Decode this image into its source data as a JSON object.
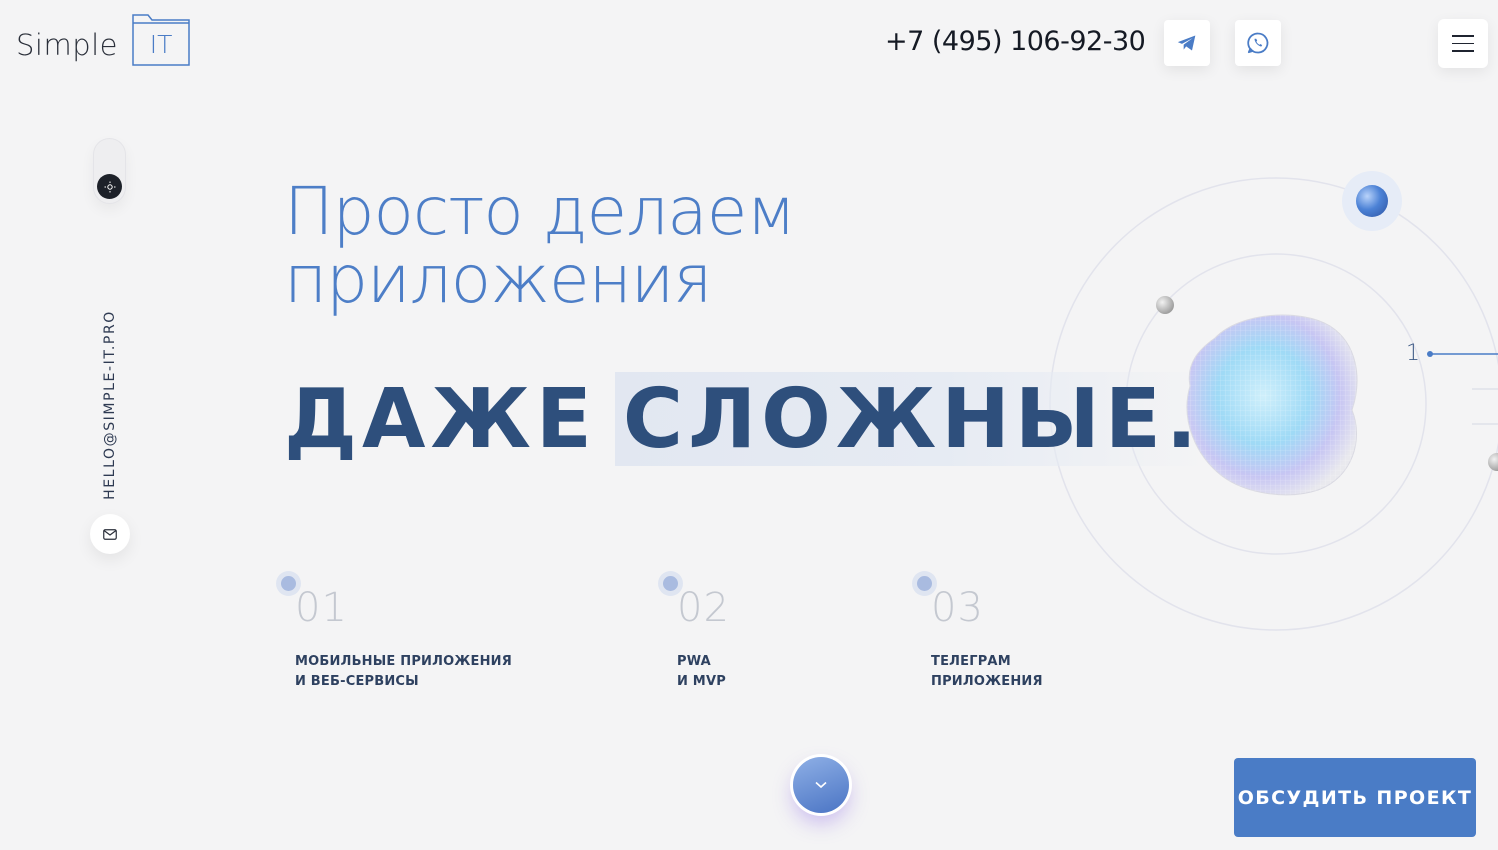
{
  "header": {
    "logo_word": "Simple",
    "logo_box": "IT",
    "phone": "+7 (495) 106-92-30",
    "telegram_icon": "telegram-icon",
    "whatsapp_icon": "whatsapp-icon",
    "menu_icon": "hamburger-icon"
  },
  "sidebar": {
    "theme_icon": "sun-icon",
    "email": "HELLO@SIMPLE-IT.PRO",
    "mail_icon": "envelope-icon"
  },
  "hero": {
    "title_line1": "Просто делаем",
    "title_line2": "приложения",
    "strong_word1": "ДАЖЕ",
    "strong_word2": "СЛОЖНЫЕ",
    "strong_dot": "."
  },
  "services": [
    {
      "num": "01",
      "line1": "МОБИЛЬНЫЕ ПРИЛОЖЕНИЯ",
      "line2": "И ВЕБ-СЕРВИСЫ"
    },
    {
      "num": "02",
      "line1": "PWA",
      "line2": "И MVP"
    },
    {
      "num": "03",
      "line1": "ТЕЛЕГРАМ",
      "line2": "ПРИЛОЖЕНИЯ"
    }
  ],
  "slider": {
    "current": "1"
  },
  "scroll_icon": "chevron-down-icon",
  "cta": {
    "label": "ОБСУДИТЬ ПРОЕКТ"
  },
  "colors": {
    "accent": "#4a7cc6",
    "dark_accent": "#2e4f7c",
    "background": "#f4f4f5"
  }
}
